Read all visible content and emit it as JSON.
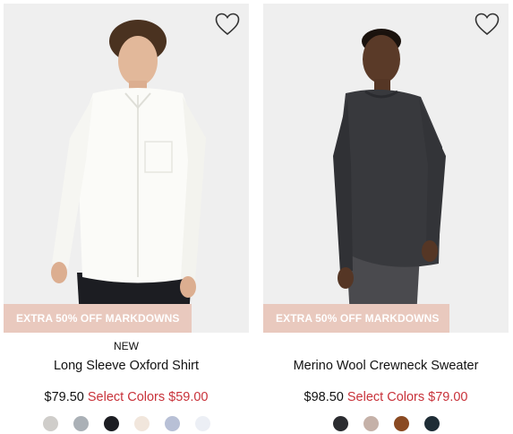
{
  "products": [
    {
      "tag": "NEW",
      "title": "Long Sleeve Oxford Shirt",
      "regular_price": "$79.50",
      "sale_label": "Select Colors $59.00",
      "badge": "EXTRA 50% OFF MARKDOWNS",
      "swatches": [
        "#cfcdca",
        "#aab0b6",
        "#1c1d22",
        "#f1e6dc",
        "#b8c0d6",
        "#eceff5"
      ]
    },
    {
      "tag": "",
      "title": "Merino Wool Crewneck Sweater",
      "regular_price": "$98.50",
      "sale_label": "Select Colors $79.00",
      "badge": "EXTRA 50% OFF MARKDOWNS",
      "swatches": [
        "#2b2c30",
        "#c5b1a8",
        "#8a4a22",
        "#1f2d36"
      ]
    }
  ],
  "colors": {
    "sale": "#c8323a",
    "badge_bg": "#e9c9be",
    "image_bg": "#efefef"
  },
  "icons": {
    "wishlist": "heart-outline-icon"
  }
}
